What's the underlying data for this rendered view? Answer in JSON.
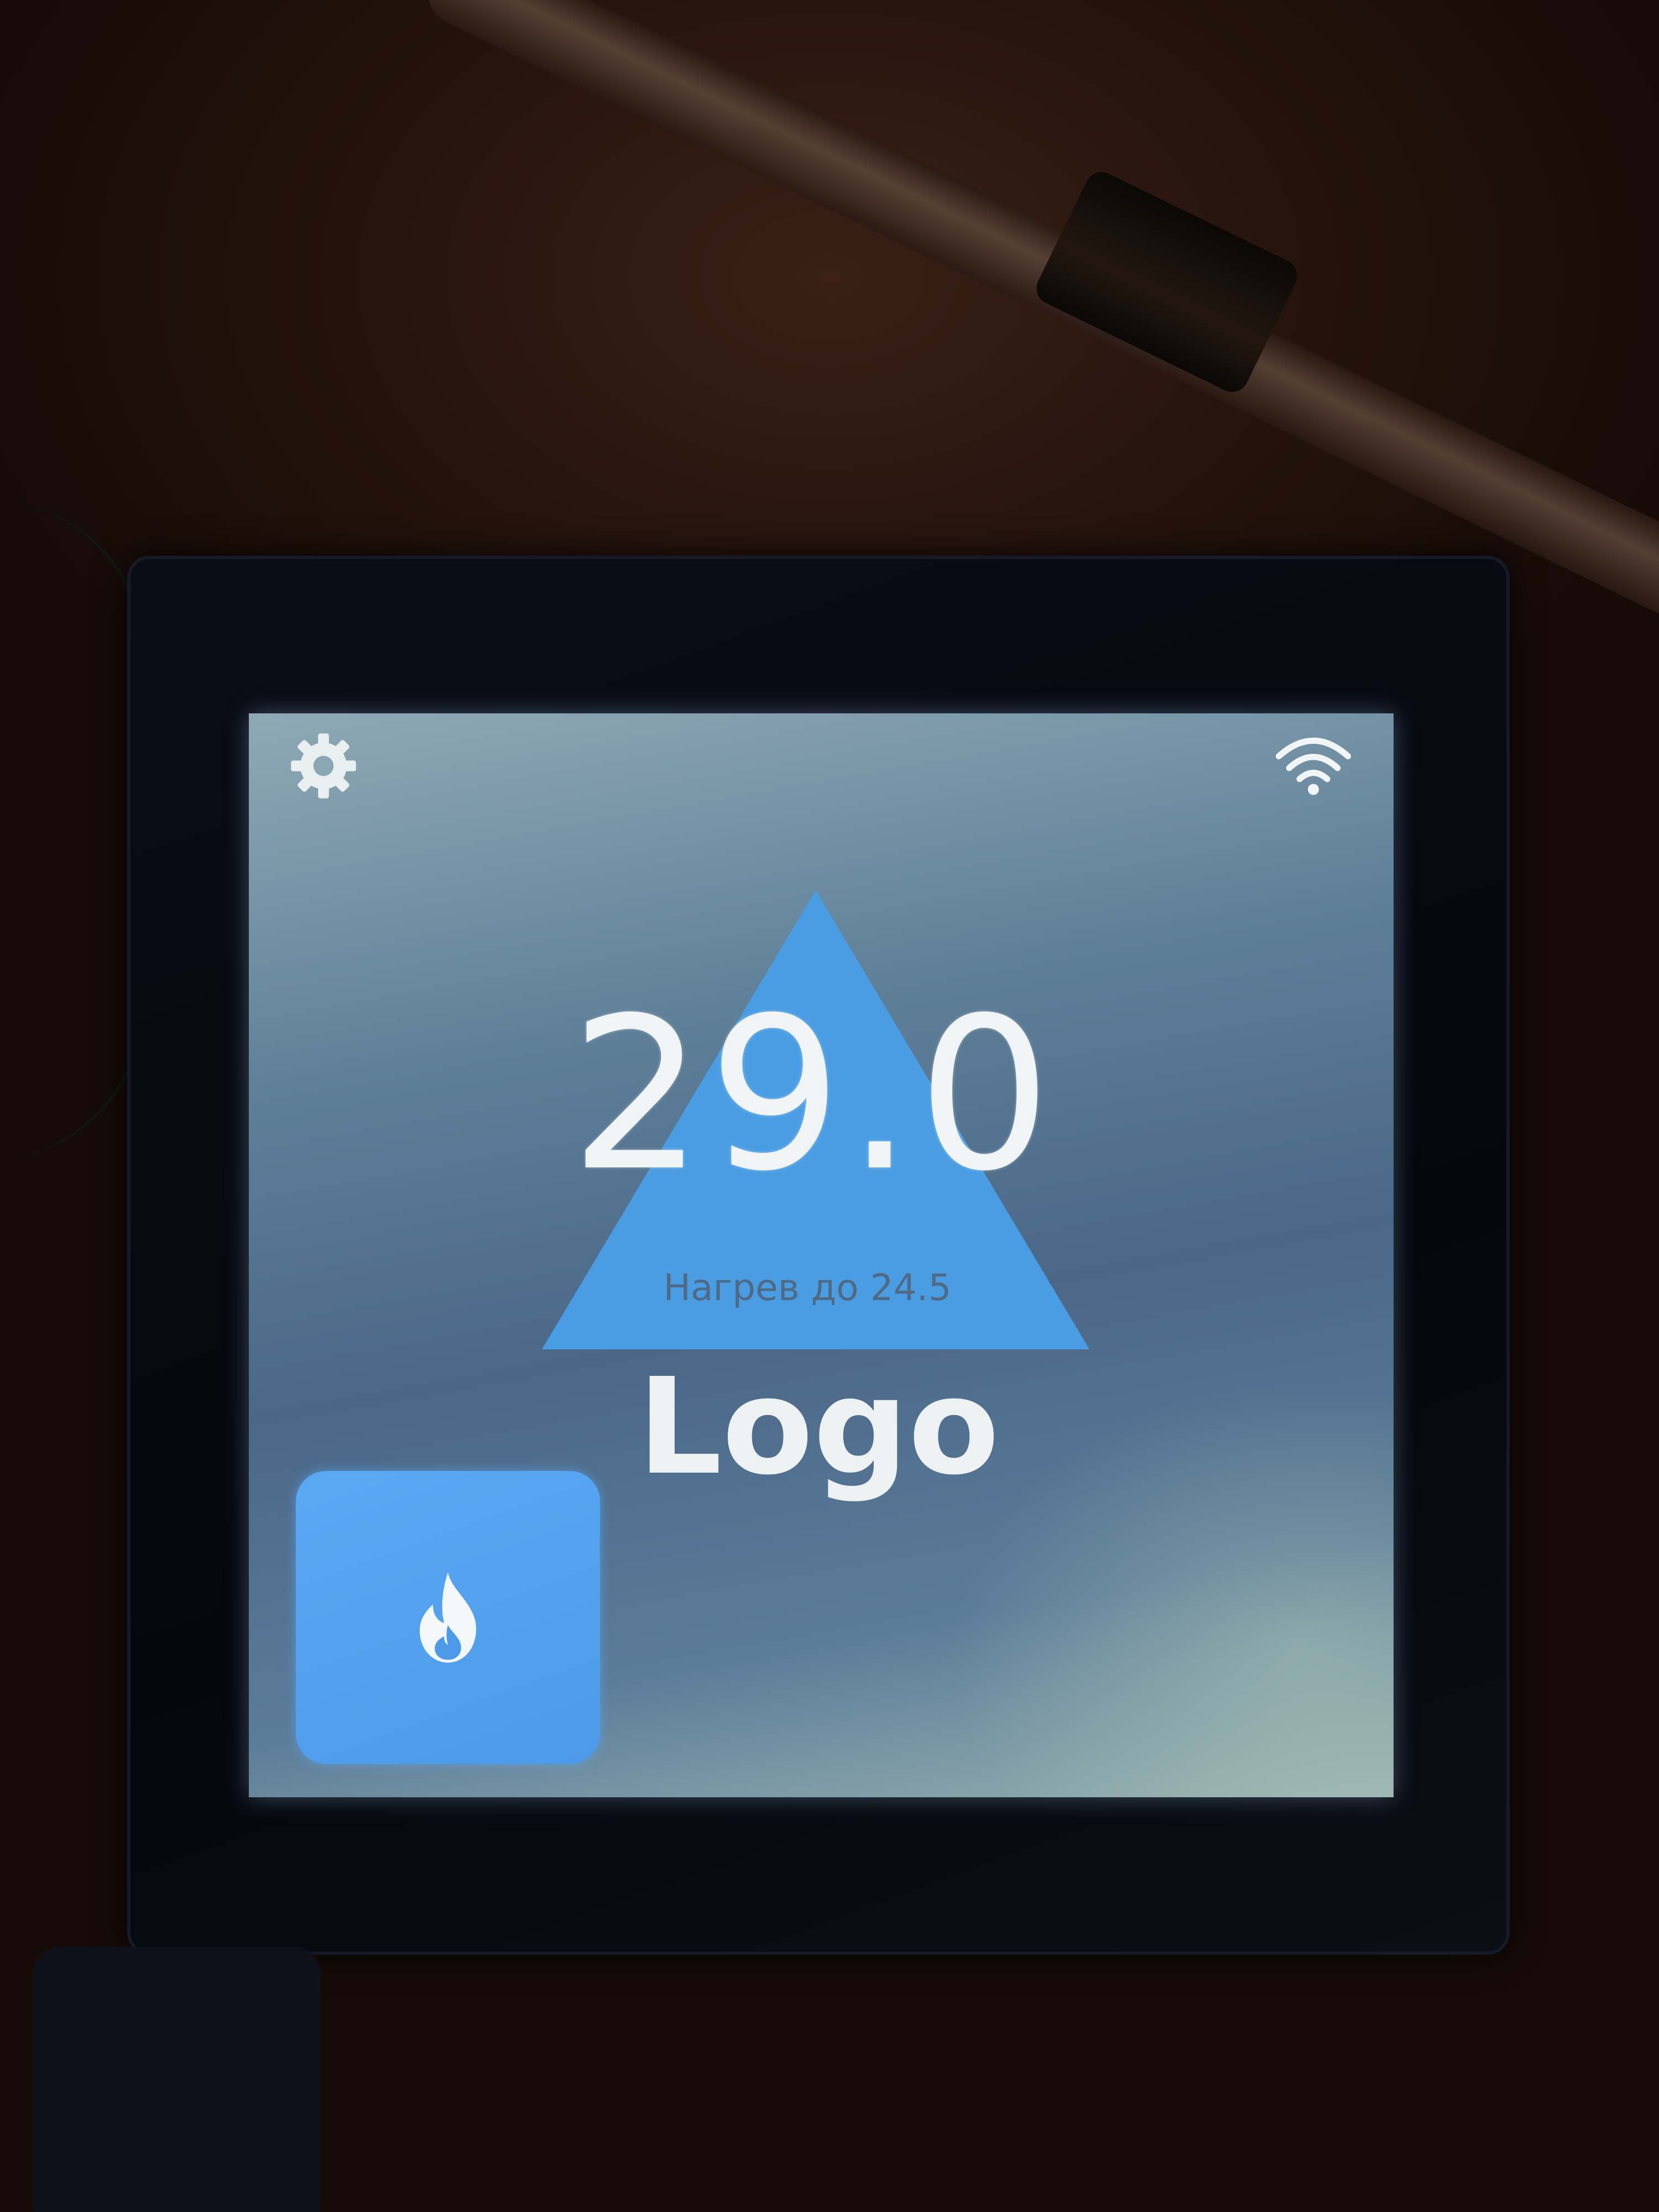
{
  "screen": {
    "current_temperature": "29.0",
    "status_text": "Нагрев до 24.5",
    "logo_text": "Logo"
  },
  "icons": {
    "settings": "gear-icon",
    "wifi": "wifi-icon",
    "heat": "flame-icon",
    "mode_indicator": "triangle-up-icon"
  },
  "colors": {
    "screen_background": "#5e7f98",
    "accent": "#4d9ae8",
    "triangle": "#4b9de3",
    "text": "#eef1f2"
  }
}
